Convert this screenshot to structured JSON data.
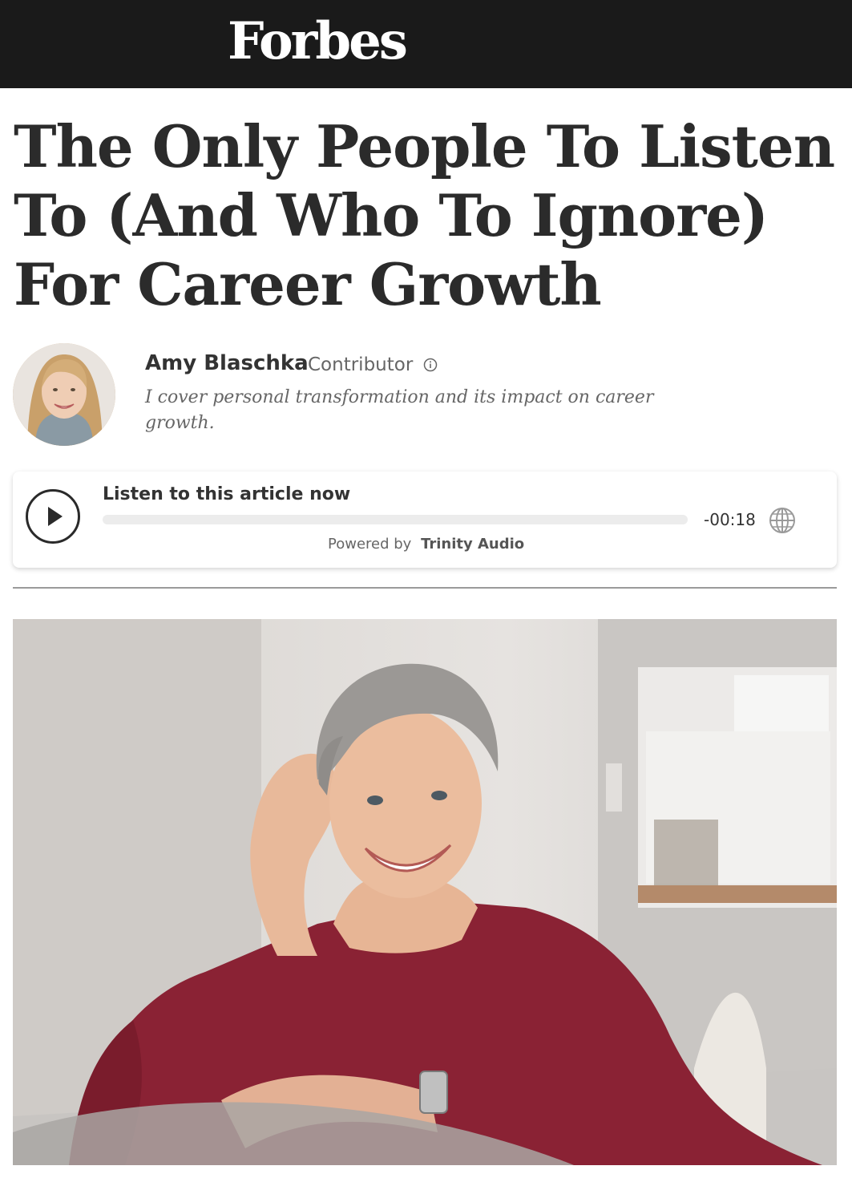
{
  "header": {
    "logo_text": "Forbes",
    "background": "#1a1a1a"
  },
  "article": {
    "headline": "The Only People To Listen To (And Who To Ignore) For Career Growth",
    "author": {
      "name": "Amy Blaschka",
      "role": "Contributor",
      "bio": "I cover personal transformation and its impact on career growth.",
      "info_icon": "info-circle-icon"
    }
  },
  "audio_player": {
    "title": "Listen to this article now",
    "time_remaining": "-00:18",
    "powered_by_label": "Powered by",
    "powered_by_brand": "Trinity Audio",
    "progress": 0,
    "play_icon": "play-icon",
    "language_icon": "globe-icon"
  },
  "hero_image": {
    "description_icon": "photo"
  }
}
